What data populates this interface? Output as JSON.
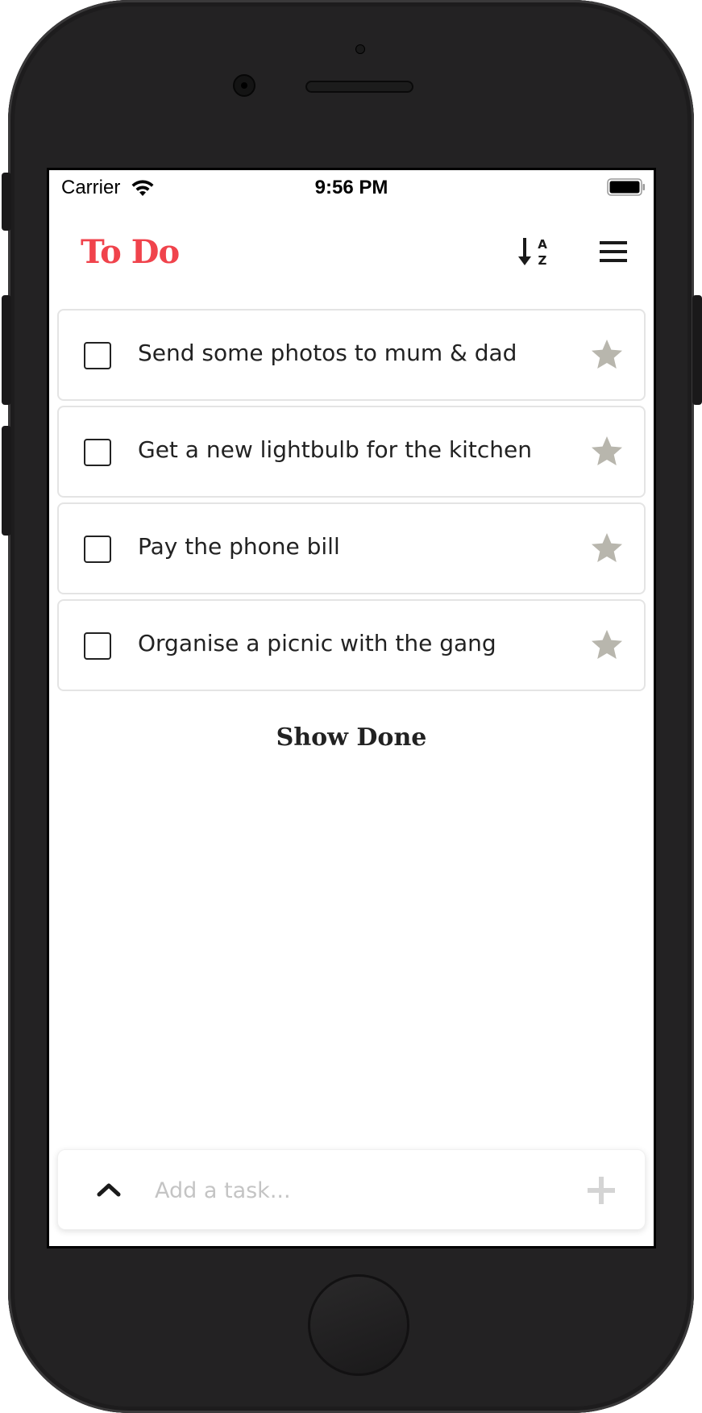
{
  "status_bar": {
    "carrier": "Carrier",
    "time": "9:56 PM",
    "wifi_icon": "wifi-icon",
    "battery_icon": "battery-icon"
  },
  "header": {
    "title": "To Do",
    "sort_icon": "sort-alpha-down-icon",
    "menu_icon": "hamburger-menu-icon"
  },
  "tasks": [
    {
      "text": "Send some photos to mum & dad",
      "done": false,
      "starred": false
    },
    {
      "text": "Get a new lightbulb for the kitchen",
      "done": false,
      "starred": false
    },
    {
      "text": "Pay the phone bill",
      "done": false,
      "starred": false
    },
    {
      "text": "Organise a picnic with the gang",
      "done": false,
      "starred": false
    }
  ],
  "show_done_label": "Show Done",
  "add_task": {
    "placeholder": "Add a task...",
    "value": "",
    "expand_icon": "chevron-up-icon",
    "add_icon": "plus-icon"
  },
  "colors": {
    "accent": "#f0434c",
    "star_inactive": "#b8b6ad",
    "text": "#222222",
    "placeholder": "#c4c4c4"
  }
}
